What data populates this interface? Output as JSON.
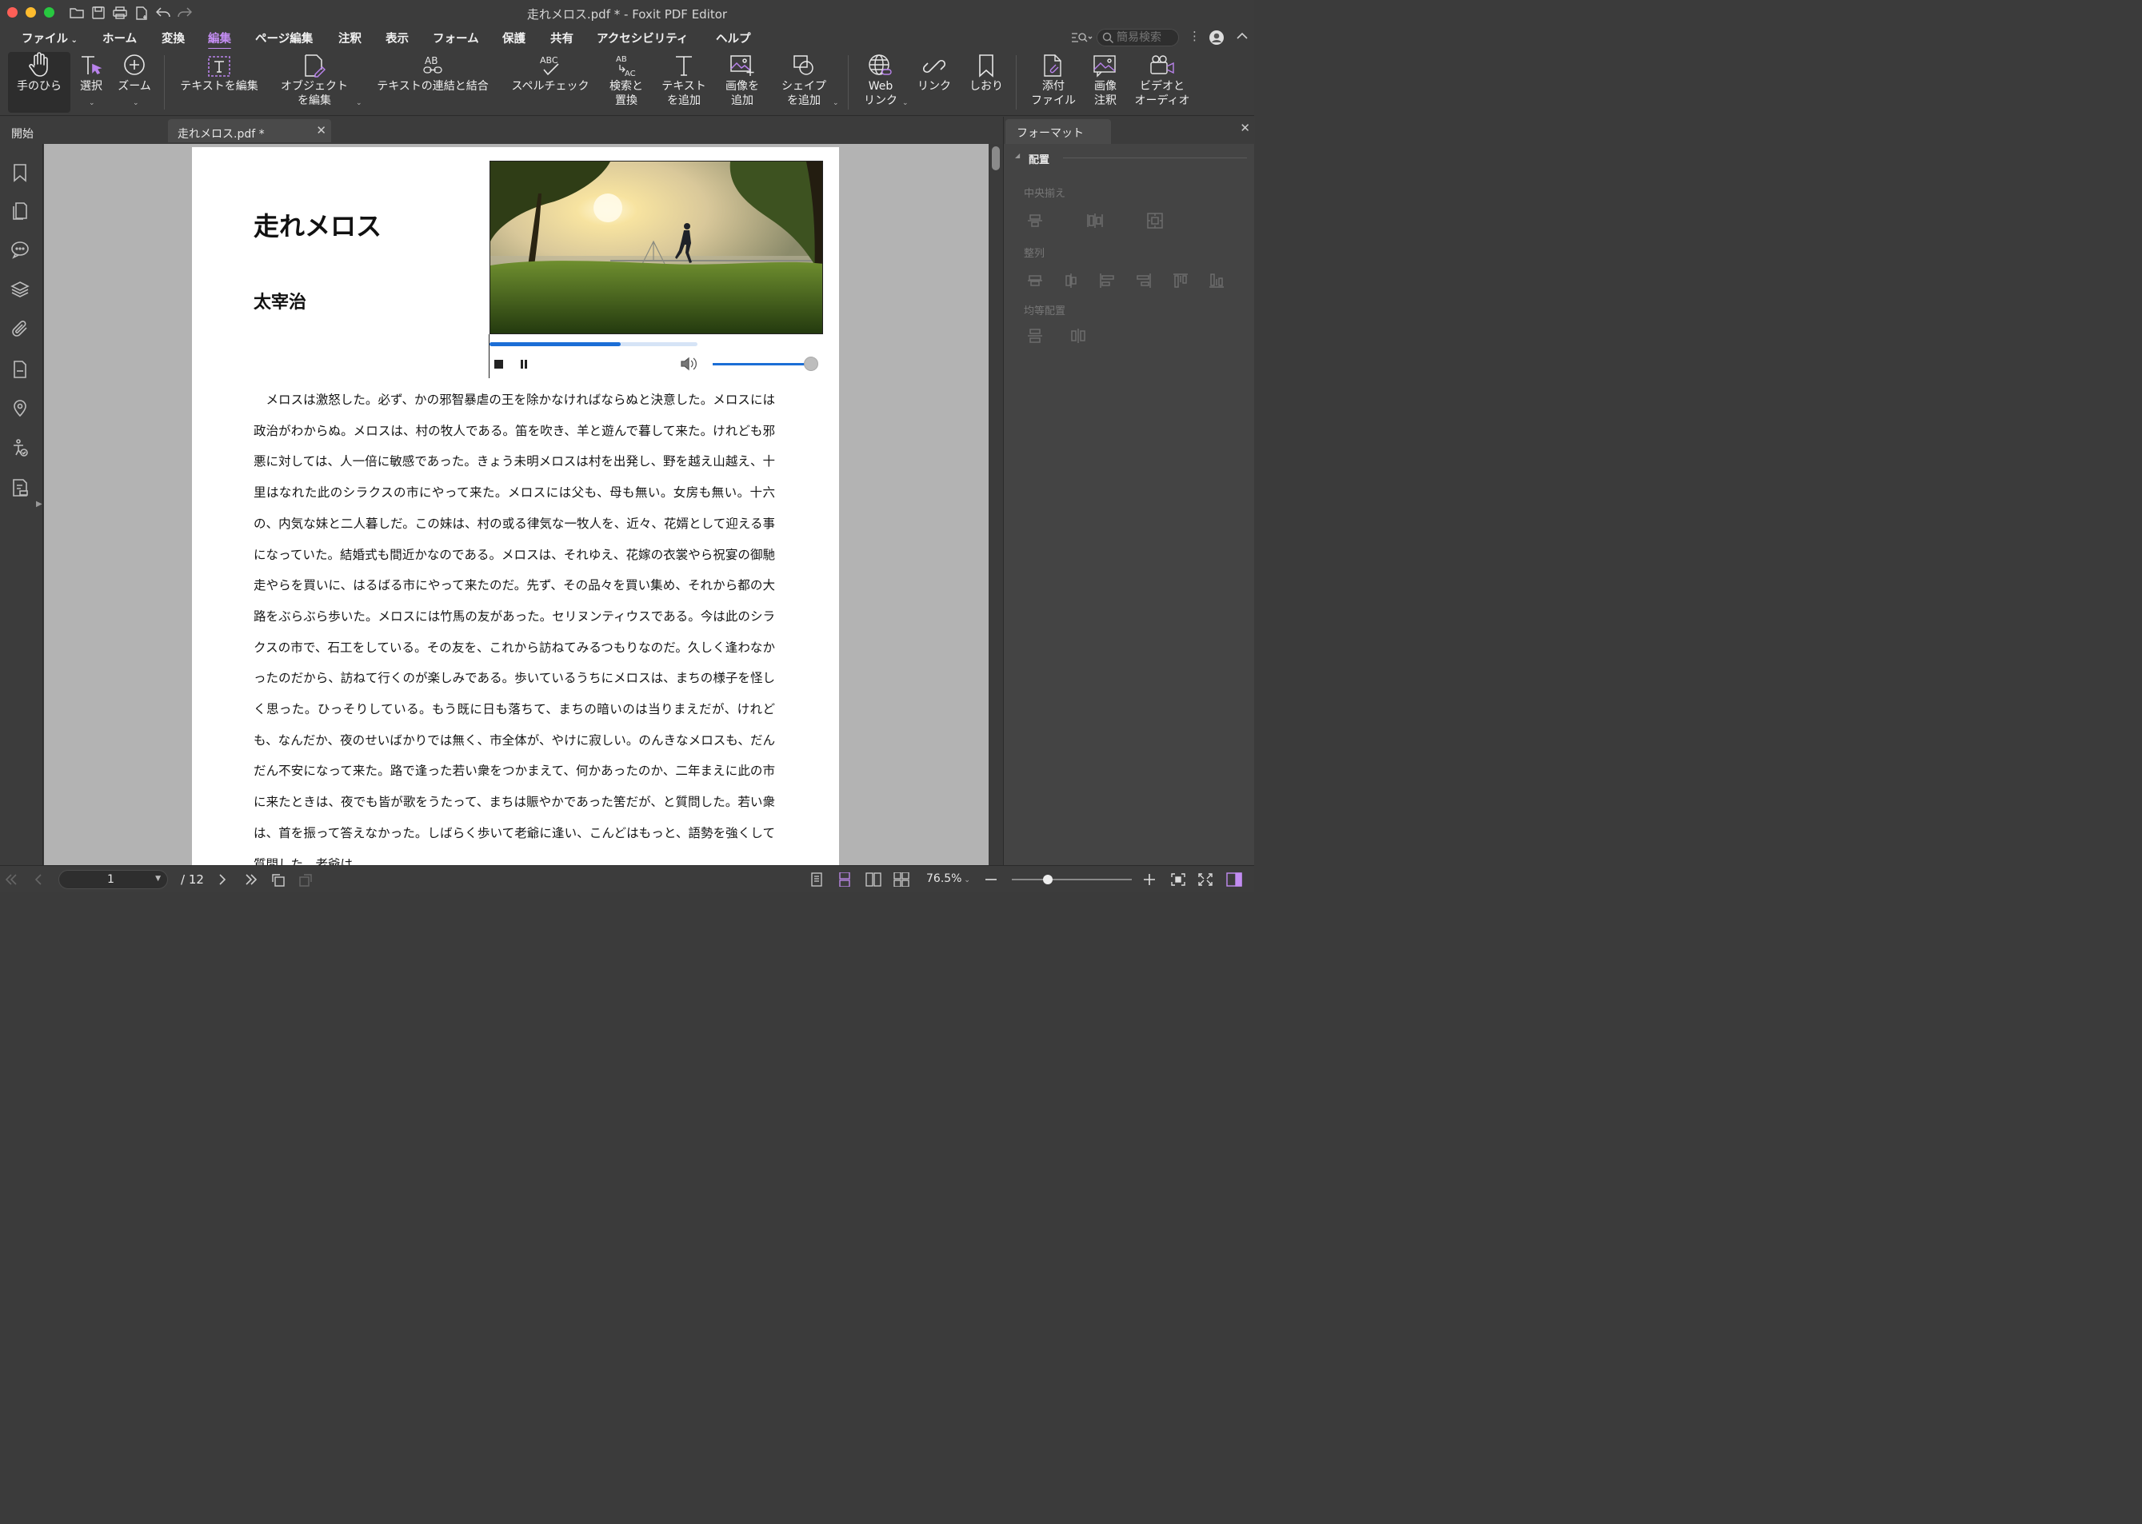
{
  "window": {
    "title": "走れメロス.pdf * - Foxit PDF Editor"
  },
  "menu": {
    "items": [
      "ファイル",
      "ホーム",
      "変換",
      "編集",
      "ページ編集",
      "注釈",
      "表示",
      "フォーム",
      "保護",
      "共有",
      "アクセシビリティ",
      "ヘルプ"
    ],
    "active": "編集",
    "search_placeholder": "簡易検索"
  },
  "ribbon": {
    "hand": "手のひら",
    "select": "選択",
    "zoom": "ズーム",
    "edit_text": "テキストを編集",
    "edit_object": "オブジェクト\nを編集",
    "link_join": "テキストの連結と結合",
    "spell": "スペルチェック",
    "find_replace": "検索と\n置換",
    "add_text": "テキスト\nを追加",
    "add_image": "画像を\n追加",
    "add_shape": "シェイプ\nを追加",
    "web_link": "Web\nリンク",
    "link": "リンク",
    "bookmark": "しおり",
    "attach": "添付\nファイル",
    "image_annot": "画像\n注釈",
    "video_audio": "ビデオと\nオーディオ"
  },
  "tabs": {
    "start": "開始",
    "doc": "走れメロス.pdf *"
  },
  "document": {
    "title": "走れメロス",
    "author": "太宰治",
    "body": "メロスは激怒した。必ず、かの邪智暴虐の王を除かなければならぬと決意した。メロスには政治がわからぬ。メロスは、村の牧人である。笛を吹き、羊と遊んで暮して来た。けれども邪悪に対しては、人一倍に敏感であった。きょう未明メロスは村を出発し、野を越え山越え、十里はなれた此のシラクスの市にやって来た。メロスには父も、母も無い。女房も無い。十六の、内気な妹と二人暮しだ。この妹は、村の或る律気な一牧人を、近々、花婿として迎える事になっていた。結婚式も間近かなのである。メロスは、それゆえ、花嫁の衣裳やら祝宴の御馳走やらを買いに、はるばる市にやって来たのだ。先ず、その品々を買い集め、それから都の大路をぶらぶら歩いた。メロスには竹馬の友があった。セリヌンティウスである。今は此のシラクスの市で、石工をしている。その友を、これから訪ねてみるつもりなのだ。久しく逢わなかったのだから、訪ねて行くのが楽しみである。歩いているうちにメロスは、まちの様子を怪しく思った。ひっそりしている。もう既に日も落ちて、まちの暗いのは当りまえだが、けれども、なんだか、夜のせいばかりでは無く、市全体が、やけに寂しい。のんきなメロスも、だんだん不安になって来た。路で逢った若い衆をつかまえて、何かあったのか、二年まえに此の市に来たときは、夜でも皆が歌をうたって、まちは賑やかであった筈だが、と質問した。若い衆は、首を振って答えなかった。しばらく歩いて老爺に逢い、こんどはもっと、語勢を強くして質問した。老爺は"
  },
  "media": {
    "playback_progress": 0.63,
    "volume": 0.98
  },
  "format_panel": {
    "tab": "フォーマット",
    "section": "配置",
    "center_label": "中央揃え",
    "align_label": "整列",
    "distribute_label": "均等配置"
  },
  "status": {
    "page": "1",
    "total": "/ 12",
    "zoom": "76.5%",
    "zoom_level": 0.3
  },
  "colors": {
    "accent": "#c38df2",
    "media_blue": "#1b6ed6",
    "toolbar_bg": "#3c3c3c",
    "canvas_bg": "#b3b3b3"
  }
}
